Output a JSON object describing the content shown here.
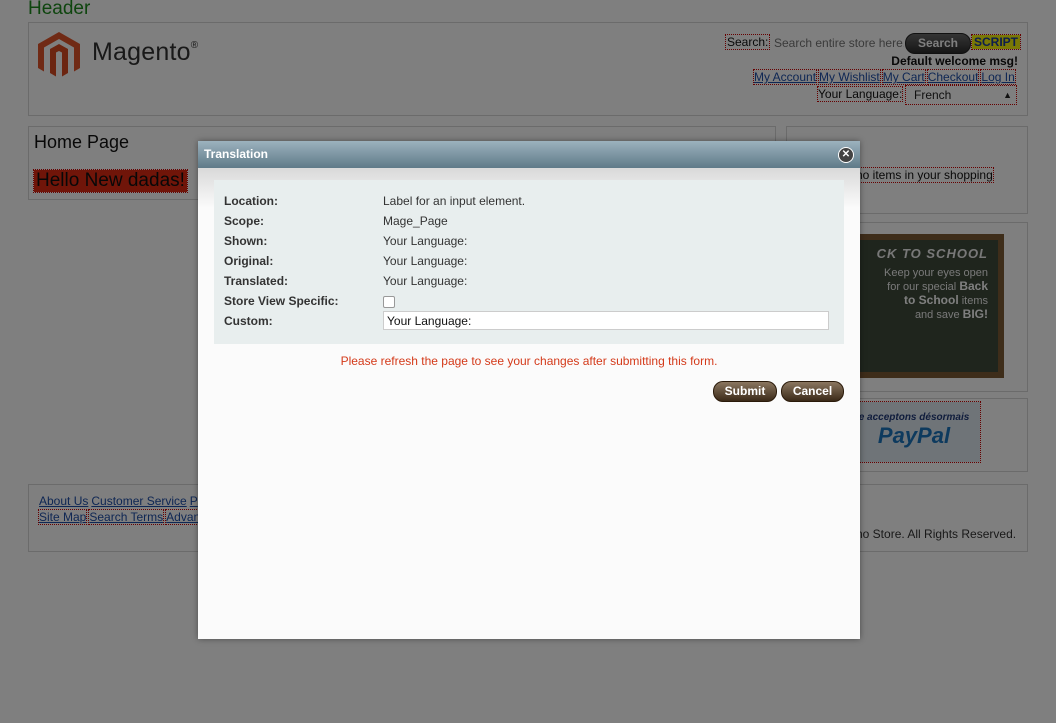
{
  "header": {
    "caption": "Header",
    "logo_text": "Magento",
    "logo_mark": "®",
    "search_label": "Search:",
    "search_placeholder": "Search entire store here...",
    "search_button": "Search",
    "script_tag": "SCRIPT",
    "welcome": "Default welcome msg!",
    "links": [
      "My Account",
      "My Wishlist",
      "My Cart",
      "Checkout",
      "Log In"
    ],
    "language_label": "Your Language:",
    "language_value": "French"
  },
  "main": {
    "title": "Home Page",
    "highlight": "Hello New dadas!"
  },
  "sidebar": {
    "cart_text": "no items in your shopping",
    "promo": {
      "headline": "CK TO SCHOOL",
      "line1": "Keep your eyes open",
      "line2a": "for our special",
      "line2b": "Back",
      "line3a": "to School",
      "line3b": "items",
      "line4a": "and save",
      "line4b": "BIG!"
    },
    "paypal": {
      "small": "e acceptons désormais",
      "brand": "PayPal"
    }
  },
  "footer": {
    "links_row1": [
      "About Us",
      "Customer Service",
      "P"
    ],
    "links_row2": [
      "Site Map",
      "Search Terms",
      "Advan"
    ],
    "copyright": "no Store. All Rights Reserved."
  },
  "modal": {
    "title": "Translation",
    "close_icon": "close-icon",
    "fields": {
      "location_label": "Location:",
      "location_value": "Label for an input element.",
      "scope_label": "Scope:",
      "scope_value": "Mage_Page",
      "shown_label": "Shown:",
      "shown_value": "Your Language:",
      "original_label": "Original:",
      "original_value": "Your Language:",
      "translated_label": "Translated:",
      "translated_value": "Your Language:",
      "store_view_label": "Store View Specific:",
      "custom_label": "Custom:",
      "custom_value": "Your Language:"
    },
    "notice": "Please refresh the page to see your changes after submitting this form.",
    "submit": "Submit",
    "cancel": "Cancel"
  },
  "colors": {
    "overlay": "#000000",
    "header_caption": "#1d8a1d",
    "highlight_bg": "#e02b13",
    "notice": "#d43a1a",
    "modal_header": "#7a96a4"
  }
}
